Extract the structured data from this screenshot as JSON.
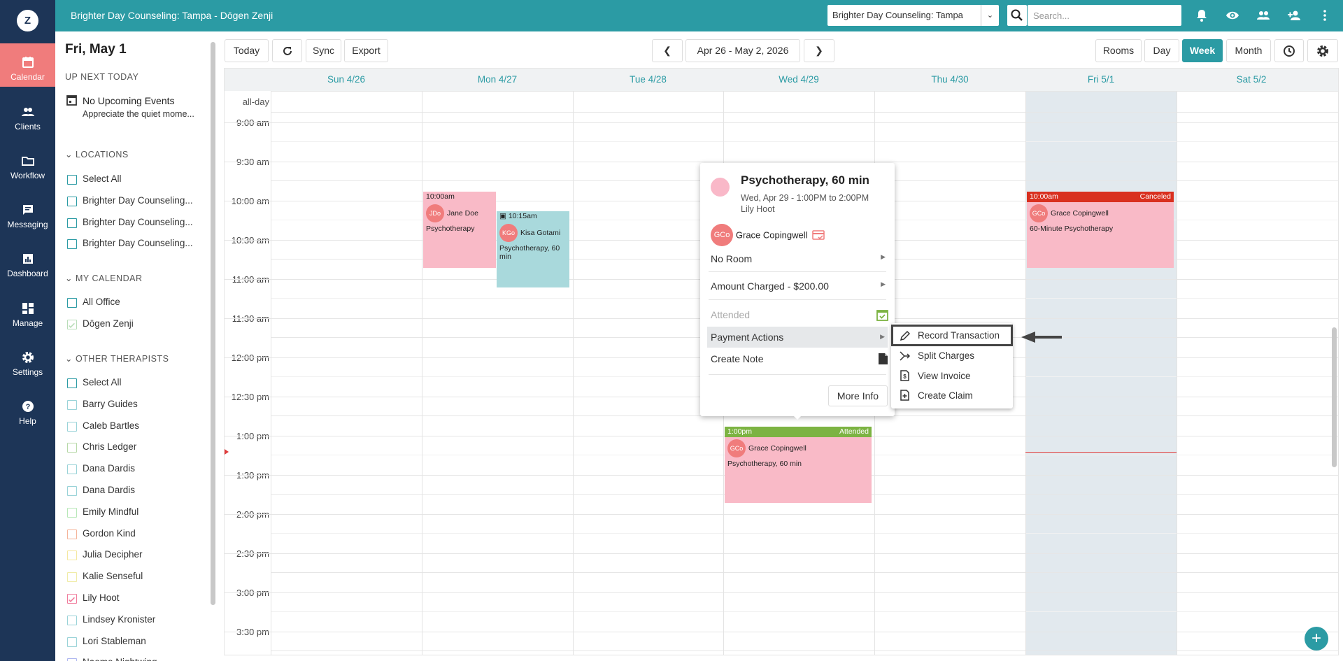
{
  "app": {
    "logo_letter": "Z",
    "title": "Brighter Day Counseling: Tampa - Dōgen Zenji"
  },
  "topbar": {
    "location_select": "Brighter Day Counseling: Tampa",
    "search_placeholder": "Search..."
  },
  "nav": [
    {
      "label": "Calendar",
      "icon": "calendar-icon",
      "active": true
    },
    {
      "label": "Clients",
      "icon": "clients-icon"
    },
    {
      "label": "Workflow",
      "icon": "folder-icon"
    },
    {
      "label": "Messaging",
      "icon": "message-icon"
    },
    {
      "label": "Dashboard",
      "icon": "chart-icon"
    },
    {
      "label": "Manage",
      "icon": "grid-icon"
    },
    {
      "label": "Settings",
      "icon": "gear-icon"
    },
    {
      "label": "Help",
      "icon": "help-icon"
    }
  ],
  "sidebar": {
    "date": "Fri, May 1",
    "up_next_heading": "UP NEXT TODAY",
    "up_next_title": "No Upcoming Events",
    "up_next_subtitle": "Appreciate the quiet mome...",
    "locations_heading": "LOCATIONS",
    "locations": [
      "Select All",
      "Brighter Day Counseling...",
      "Brighter Day Counseling...",
      "Brighter Day Counseling..."
    ],
    "my_calendar_heading": "MY CALENDAR",
    "my_calendar": [
      "All Office",
      "Dōgen Zenji"
    ],
    "other_heading": "OTHER THERAPISTS",
    "therapists": [
      "Select All",
      "Barry Guides",
      "Caleb Bartles",
      "Chris Ledger",
      "Dana Dardis",
      "Dana Dardis",
      "Emily Mindful",
      "Gordon Kind",
      "Julia Decipher",
      "Kalie Senseful",
      "Lily Hoot",
      "Lindsey Kronister",
      "Lori Stableman",
      "Naomo Nightwing"
    ],
    "therapist_colors": [
      "#2b9ba4",
      "#9ad3d8",
      "#9ad3d8",
      "#b7d9a8",
      "#9ad3d8",
      "#9ad3d8",
      "#b8e8b8",
      "#f5b49a",
      "#f5e8a0",
      "#f0eca8",
      "#f07c9c",
      "#9ad3d8",
      "#9ad3d8",
      "#b0b8f0"
    ]
  },
  "toolbar": {
    "today": "Today",
    "sync": "Sync",
    "export": "Export",
    "range": "Apr 26 - May 2, 2026",
    "rooms": "Rooms",
    "day": "Day",
    "week": "Week",
    "month": "Month"
  },
  "calendar": {
    "days": [
      "Sun 4/26",
      "Mon 4/27",
      "Tue 4/28",
      "Wed 4/29",
      "Thu 4/30",
      "Fri 5/1",
      "Sat 5/2"
    ],
    "allday": "all-day",
    "times": [
      "9:00 am",
      "9:30 am",
      "10:00 am",
      "10:30 am",
      "11:00 am",
      "11:30 am",
      "12:00 pm",
      "12:30 pm",
      "1:00 pm",
      "1:30 pm",
      "2:00 pm",
      "2:30 pm",
      "3:00 pm",
      "3:30 pm"
    ]
  },
  "events": {
    "jane": {
      "time": "10:00am",
      "initials": "JDo",
      "name": "Jane Doe",
      "service": "Psychotherapy"
    },
    "kisa": {
      "time": "10:15am",
      "initials": "KGo",
      "name": "Kisa Gotami",
      "service": "Psychotherapy, 60 min"
    },
    "grace_fri": {
      "time": "10:00am",
      "status": "Canceled",
      "initials": "GCo",
      "name": "Grace Copingwell",
      "service": "60-Minute Psychotherapy"
    },
    "grace_wed": {
      "time": "1:00pm",
      "status": "Attended",
      "initials": "GCo",
      "name": "Grace Copingwell",
      "service": "Psychotherapy, 60 min"
    }
  },
  "popover": {
    "title": "Psychotherapy, 60 min",
    "when": "Wed, Apr 29 - 1:00PM to 2:00PM",
    "clinician": "Lily Hoot",
    "client_initials": "GCo",
    "client_name": "Grace Copingwell",
    "room": "No Room",
    "amount": "Amount Charged - $200.00",
    "attended": "Attended",
    "payment_actions": "Payment Actions",
    "create_note": "Create Note",
    "more_info": "More Info"
  },
  "submenu": {
    "record": "Record Transaction",
    "split": "Split Charges",
    "invoice": "View Invoice",
    "claim": "Create Claim"
  }
}
